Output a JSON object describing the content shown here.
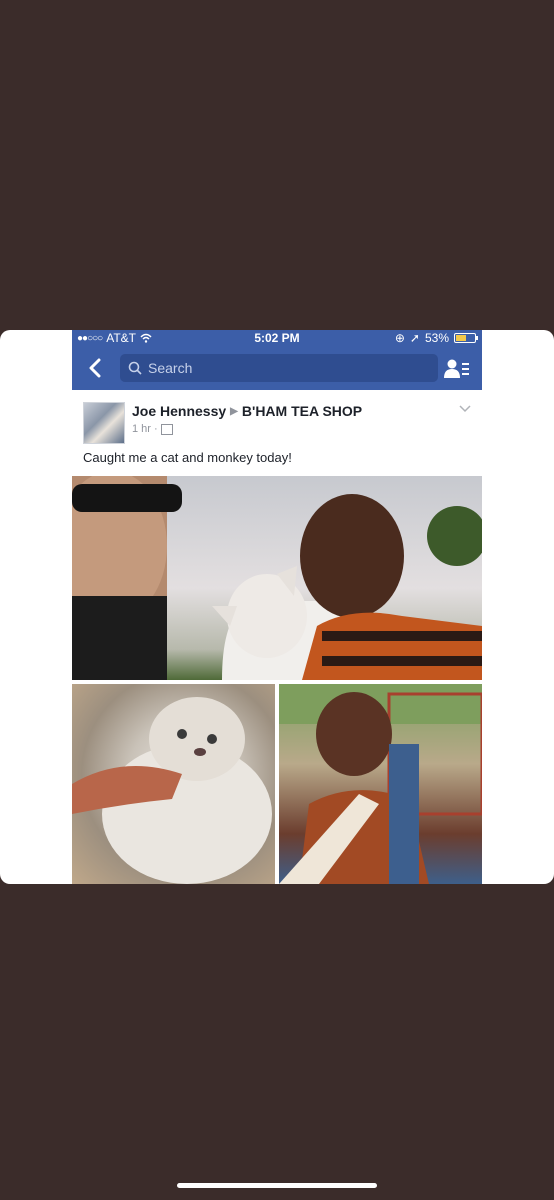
{
  "status_bar": {
    "carrier": "AT&T",
    "time": "5:02 PM",
    "battery": "53%",
    "battery_level": 0.53
  },
  "nav": {
    "search_placeholder": "Search"
  },
  "post": {
    "author": "Joe Hennessy",
    "target": "B'HAM TEA SHOP",
    "time_ago": "1 hr ·",
    "caption": "Caught me a cat and monkey today!"
  },
  "colors": {
    "facebook_blue": "#3c5ea8",
    "page_background": "#3b2c2a"
  },
  "icons": [
    "back-icon",
    "search-icon",
    "friends-icon",
    "chevron-down-icon",
    "wifi-icon",
    "location-icon",
    "calendar-icon"
  ]
}
